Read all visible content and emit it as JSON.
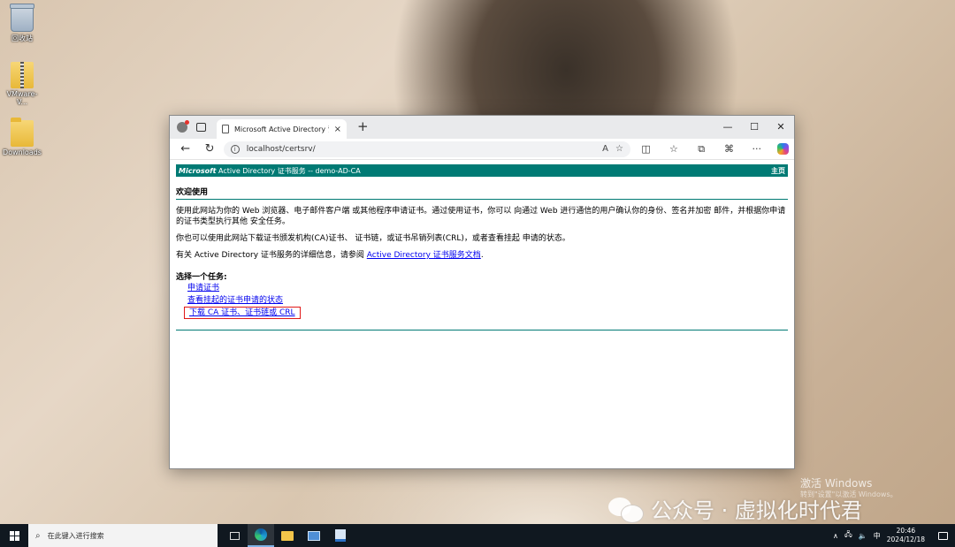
{
  "desktop": {
    "icons": [
      {
        "label": "回收站"
      },
      {
        "label": "VMware-V..."
      },
      {
        "label": "Downloads"
      }
    ]
  },
  "browser": {
    "tab": {
      "title": "Microsoft Active Directory 证书服",
      "close": "×"
    },
    "new_tab": "+",
    "window_controls": {
      "minimize": "—",
      "maximize": "☐",
      "close": "✕"
    },
    "nav": {
      "back": "←",
      "refresh": "↻"
    },
    "url": "localhost/certsrv/",
    "read_aloud": "A",
    "favorite": "☆",
    "toolbar": {
      "split": "◫",
      "favorites": "☆",
      "collections": "⧉",
      "extensions": "⌘",
      "more": "···"
    }
  },
  "page": {
    "header": {
      "brand": "Microsoft",
      "title": " Active Directory 证书服务  --  demo-AD-CA",
      "home": "主页"
    },
    "welcome": "欢迎使用",
    "para1": "使用此网站为你的 Web 浏览器、电子邮件客户端 或其他程序申请证书。通过使用证书，你可以 向通过 Web 进行通信的用户确认你的身份、签名并加密 邮件，并根据你申请的证书类型执行其他 安全任务。",
    "para2": "你也可以使用此网站下载证书颁发机构(CA)证书、 证书链，或证书吊销列表(CRL)，或者查看挂起 申请的状态。",
    "para3_prefix": "有关 Active Directory 证书服务的详细信息，请参阅 ",
    "para3_link": "Active Directory 证书服务文档",
    "para3_suffix": ".",
    "task_title": "选择一个任务:",
    "tasks": [
      {
        "label": "申请证书"
      },
      {
        "label": "查看挂起的证书申请的状态"
      },
      {
        "label": "下载 CA 证书、证书链或 CRL"
      }
    ]
  },
  "watermark": {
    "activate": "激活 Windows",
    "activate_sub": "转到\"设置\"以激活 Windows。",
    "wechat": "公众号 · 虚拟化时代君"
  },
  "taskbar": {
    "search_placeholder": "在此键入进行搜索",
    "tray": {
      "arrow": "∧",
      "ime": "中",
      "time": "20:46",
      "date": "2024/12/18"
    }
  }
}
